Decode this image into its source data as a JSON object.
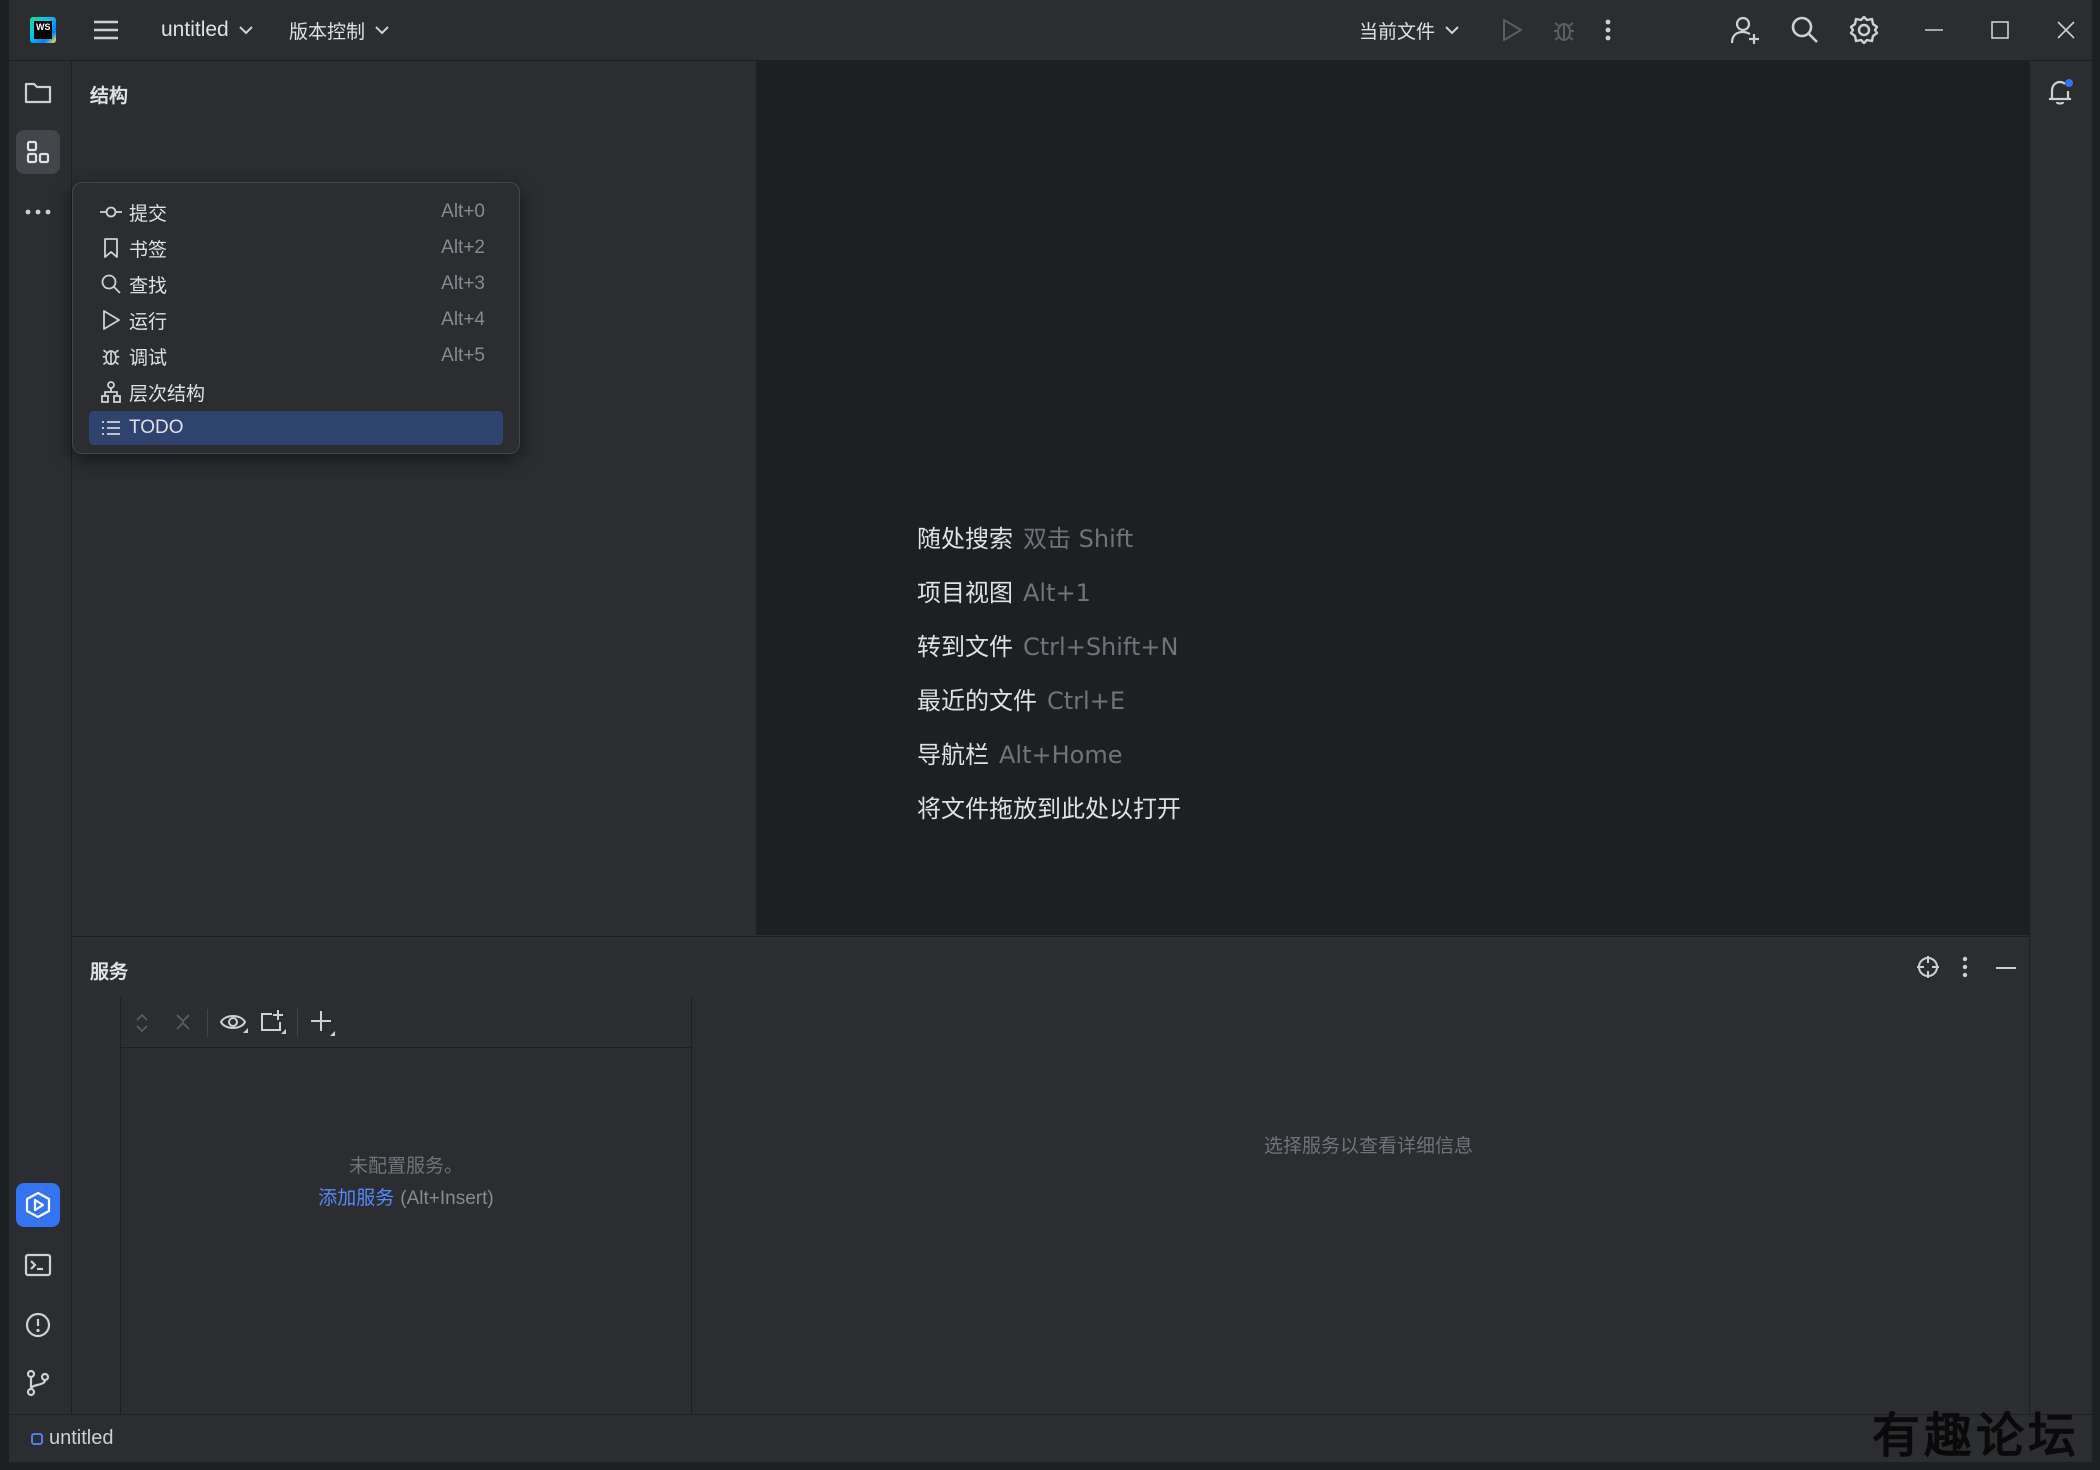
{
  "titlebar": {
    "project": "untitled",
    "vcs": "版本控制",
    "run_config": "当前文件"
  },
  "structure": {
    "title": "结构"
  },
  "popup": {
    "items": [
      {
        "label": "提交",
        "shortcut": "Alt+0"
      },
      {
        "label": "书签",
        "shortcut": "Alt+2"
      },
      {
        "label": "查找",
        "shortcut": "Alt+3"
      },
      {
        "label": "运行",
        "shortcut": "Alt+4"
      },
      {
        "label": "调试",
        "shortcut": "Alt+5"
      },
      {
        "label": "层次结构",
        "shortcut": ""
      },
      {
        "label": "TODO",
        "shortcut": ""
      }
    ]
  },
  "editor": {
    "hints": [
      {
        "label": "随处搜索",
        "shortcut": "双击 Shift"
      },
      {
        "label": "项目视图",
        "shortcut": "Alt+1"
      },
      {
        "label": "转到文件",
        "shortcut": "Ctrl+Shift+N"
      },
      {
        "label": "最近的文件",
        "shortcut": "Ctrl+E"
      },
      {
        "label": "导航栏",
        "shortcut": "Alt+Home"
      },
      {
        "label": "将文件拖放到此处以打开",
        "shortcut": ""
      }
    ]
  },
  "services": {
    "title": "服务",
    "empty_line1": "未配置服务。",
    "add_link": "添加服务",
    "add_shortcut": "(Alt+Insert)",
    "detail_placeholder": "选择服务以查看详细信息"
  },
  "statusbar": {
    "project": "untitled"
  },
  "watermark": "有趣论坛",
  "colors": {
    "accent": "#3574f0",
    "selection": "#2e436e",
    "link": "#548af7"
  }
}
